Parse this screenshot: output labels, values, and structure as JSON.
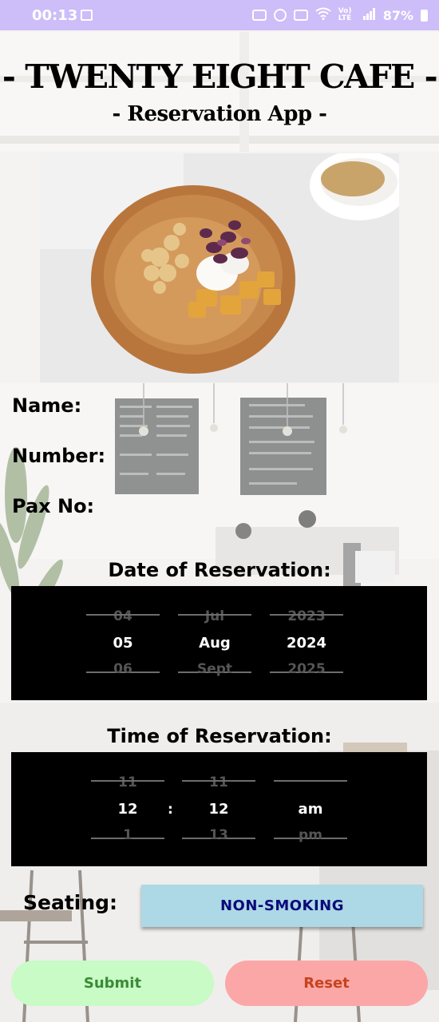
{
  "status_bar": {
    "time": "00:13",
    "battery": "87%",
    "network": "Vo) LTE",
    "icons": [
      "image-icon",
      "sleep-icon",
      "alarm-icon",
      "mute-icon",
      "wifi-icon",
      "signal-icon",
      "battery-icon"
    ]
  },
  "header": {
    "title": "- TWENTY EIGHT CAFE -",
    "subtitle": "- Reservation App -"
  },
  "form": {
    "name_label": "Name:",
    "number_label": "Number:",
    "pax_label": "Pax No:"
  },
  "date_picker": {
    "title": "Date of Reservation:",
    "day": {
      "prev": "04",
      "current": "05",
      "next": "06"
    },
    "month": {
      "prev": "Jul",
      "current": "Aug",
      "next": "Sept"
    },
    "year": {
      "prev": "2023",
      "current": "2024",
      "next": "2025"
    }
  },
  "time_picker": {
    "title": "Time of Reservation:",
    "hour": {
      "prev": "11",
      "current": "12",
      "next": "1"
    },
    "separator": ":",
    "minute": {
      "prev": "11",
      "current": "12",
      "next": "13"
    },
    "ampm": {
      "prev": "",
      "current": "am",
      "next": "pm"
    }
  },
  "seating": {
    "label": "Seating:",
    "value": "NON-SMOKING"
  },
  "actions": {
    "submit_label": "Submit",
    "reset_label": "Reset"
  },
  "colors": {
    "status_bar": "#cdbdf8",
    "seating_button": "#add8e6",
    "submit_bg": "#c8fbc5",
    "submit_text": "#3a8a37",
    "reset_bg": "#fba7a7",
    "reset_text": "#c5431e"
  }
}
